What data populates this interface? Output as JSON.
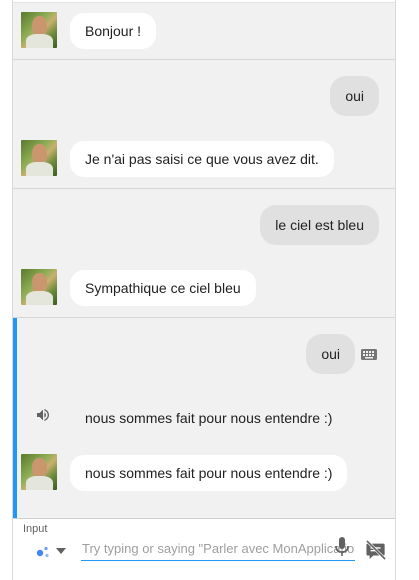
{
  "conversation": [
    {
      "speaker": "agent",
      "text": "Bonjour !"
    },
    {
      "speaker": "user",
      "text": "oui"
    },
    {
      "speaker": "agent",
      "text": "Je n'ai pas saisi ce que vous avez dit."
    },
    {
      "speaker": "user",
      "text": "le ciel est bleu"
    },
    {
      "speaker": "agent",
      "text": "Sympathique ce ciel bleu"
    },
    {
      "speaker": "user",
      "text": "oui",
      "input_mode": "keyboard-icon"
    },
    {
      "speaker": "agent",
      "audio_icon": "speaker-icon",
      "text": "nous sommes fait pour nous entendre :)"
    },
    {
      "speaker": "agent",
      "text": "nous sommes fait pour nous entendre :)"
    }
  ],
  "input": {
    "label": "Input",
    "placeholder": "Try typing or saying \"Parler avec MonApplication\"",
    "value": "",
    "assistant_icon": "assistant-dots-icon",
    "dropdown_icon": "caret-down-icon",
    "mic_icon": "microphone-icon",
    "mute_icon": "speech-off-icon"
  },
  "colors": {
    "accent": "#2196f3",
    "panel_bg": "#f1f1f1",
    "agent_bubble": "#ffffff",
    "user_bubble": "#e0e0e0"
  }
}
